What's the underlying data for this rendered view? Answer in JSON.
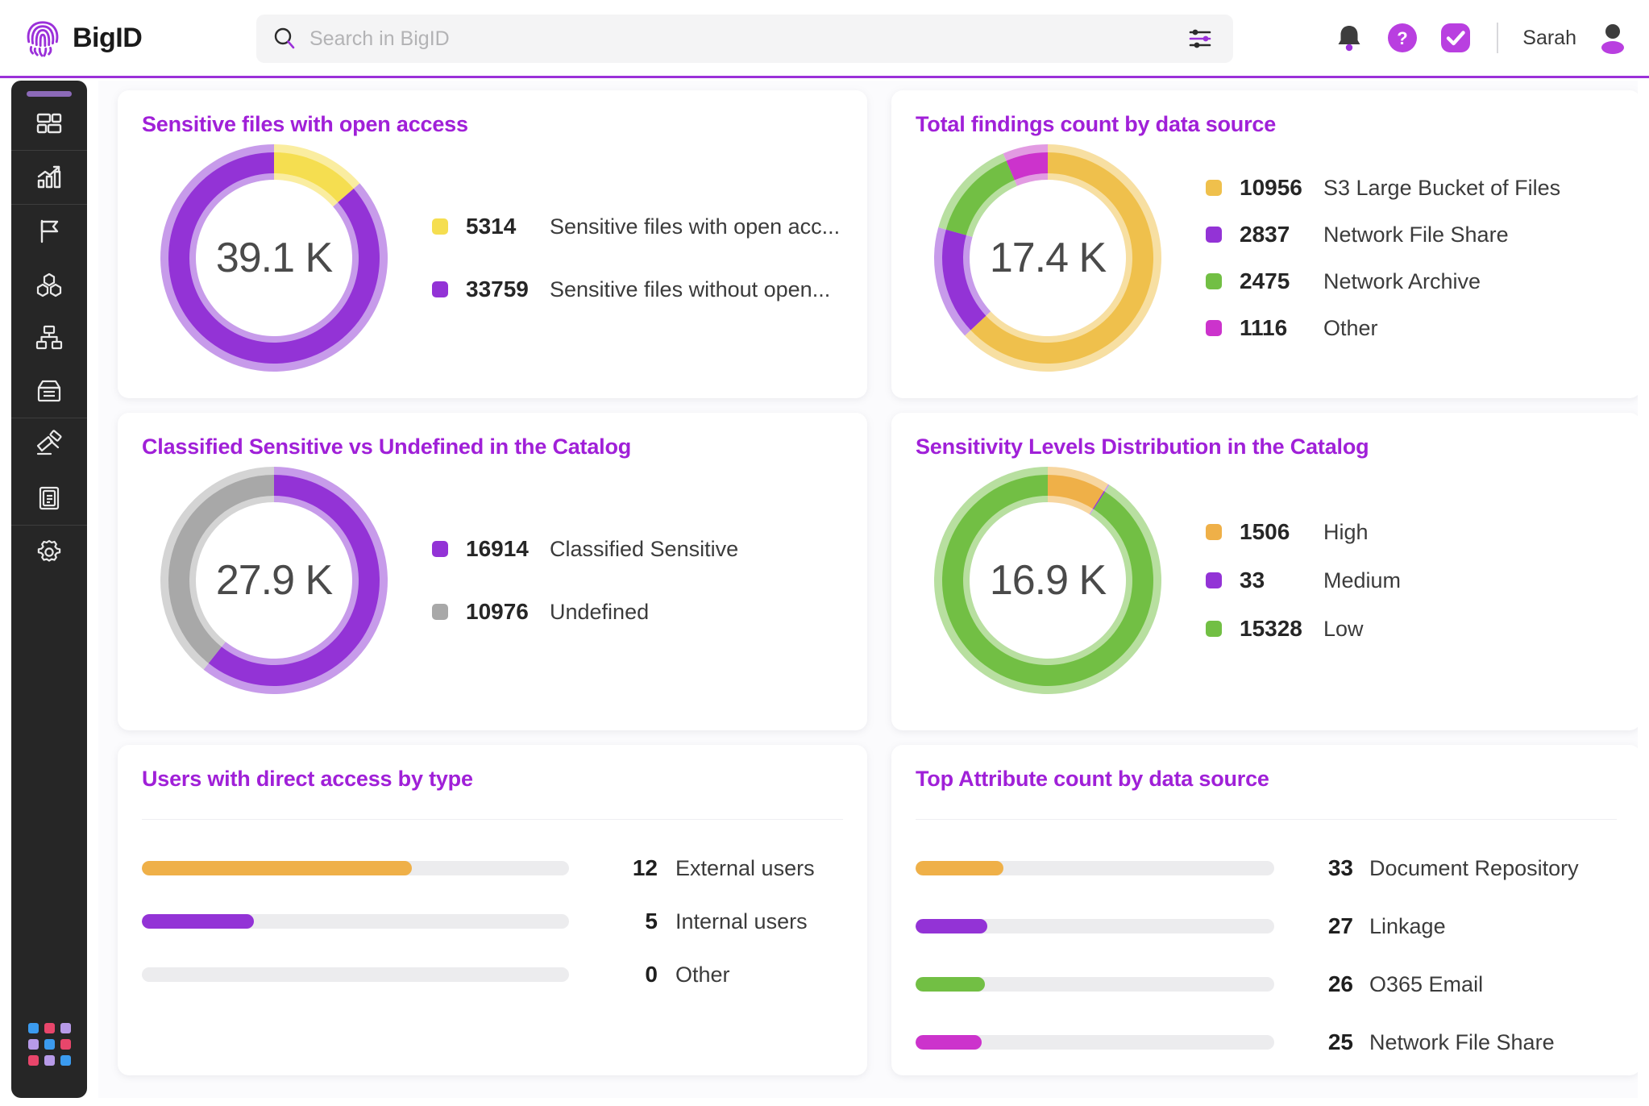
{
  "header": {
    "brand": "BigID",
    "brand_logo_icon": "fingerprint-icon",
    "search_placeholder": "Search in BigID",
    "search_value": "",
    "search_icon": "search-icon",
    "filter_icon": "filter-sliders-icon",
    "notifications_icon": "bell-icon",
    "help_icon": "question-circle-icon",
    "tasks_icon": "check-circle-icon",
    "user_name": "Sarah",
    "avatar_icon": "user-avatar-icon"
  },
  "sidebar": {
    "items": [
      {
        "name": "dashboard",
        "icon": "dashboard-grid-icon"
      },
      {
        "name": "insights",
        "icon": "bar-chart-trend-icon"
      },
      {
        "name": "data-overview",
        "icon": "flag-icon"
      },
      {
        "name": "clusters",
        "icon": "hexagons-icon"
      },
      {
        "name": "data-sources",
        "icon": "sitemap-icon"
      },
      {
        "name": "catalog",
        "icon": "archive-drawer-icon"
      },
      {
        "name": "policies",
        "icon": "gavel-icon"
      },
      {
        "name": "reports",
        "icon": "clipboard-icon"
      },
      {
        "name": "settings",
        "icon": "gear-icon"
      }
    ],
    "app_switcher_icon": "app-grid-dots-icon",
    "dot_colors": [
      "#3b9bef",
      "#e8466b",
      "#b79ae8",
      "#b79ae8",
      "#3b9bef",
      "#e8466b",
      "#e8466b",
      "#b79ae8",
      "#3b9bef"
    ]
  },
  "colors": {
    "brand_purple": "#A020D8",
    "purple": "#9333D6",
    "purple_light": "#C79BEA",
    "yellow": "#F5DE50",
    "yellow_light": "#FAEDA0",
    "amber": "#EFC04C",
    "amber_light": "#F7DFA2",
    "orange": "#EFB048",
    "green": "#72BF44",
    "green_light": "#B8DFA0",
    "magenta": "#CC33CC",
    "magenta_light": "#E29BE2",
    "gray": "#A8A8A8",
    "gray_light": "#D4D4D4",
    "track": "#ECECEE"
  },
  "chart_data": [
    {
      "id": "sensitive-files-open-access",
      "type": "pie",
      "title": "Sensitive files with open access",
      "center_label": "39.1 K",
      "total": 39073,
      "legend_position": "right",
      "slices": [
        {
          "label": "Sensitive files with open acc...",
          "full_label": "Sensitive files with open access",
          "value": 5314,
          "color": "#F5DE50",
          "halo": "#FAEDA0"
        },
        {
          "label": "Sensitive files without open...",
          "full_label": "Sensitive files without open access",
          "value": 33759,
          "color": "#9333D6",
          "halo": "#C79BEA"
        }
      ]
    },
    {
      "id": "total-findings-by-data-source",
      "type": "pie",
      "title": "Total findings count by data source",
      "center_label": "17.4 K",
      "total": 17384,
      "legend_position": "right",
      "slices": [
        {
          "label": "S3 Large Bucket of Files",
          "value": 10956,
          "color": "#EFC04C",
          "halo": "#F7DFA2"
        },
        {
          "label": "Network File Share",
          "value": 2837,
          "color": "#9333D6",
          "halo": "#C79BEA"
        },
        {
          "label": "Network Archive",
          "value": 2475,
          "color": "#72BF44",
          "halo": "#B8DFA0"
        },
        {
          "label": "Other",
          "value": 1116,
          "color": "#CC33CC",
          "halo": "#E29BE2"
        }
      ]
    },
    {
      "id": "classified-sensitive-vs-undefined",
      "type": "pie",
      "title": "Classified Sensitive vs Undefined in the Catalog",
      "center_label": "27.9 K",
      "total": 27890,
      "legend_position": "right",
      "slices": [
        {
          "label": "Classified Sensitive",
          "value": 16914,
          "color": "#9333D6",
          "halo": "#C79BEA"
        },
        {
          "label": "Undefined",
          "value": 10976,
          "color": "#A8A8A8",
          "halo": "#D4D4D4"
        }
      ]
    },
    {
      "id": "sensitivity-levels-distribution",
      "type": "pie",
      "title": "Sensitivity Levels Distribution in the Catalog",
      "center_label": "16.9 K",
      "total": 16867,
      "legend_position": "right",
      "slices": [
        {
          "label": "High",
          "value": 1506,
          "color": "#EFB048",
          "halo": "#F7D6A0"
        },
        {
          "label": "Medium",
          "value": 33,
          "color": "#9333D6",
          "halo": "#C79BEA"
        },
        {
          "label": "Low",
          "value": 15328,
          "color": "#72BF44",
          "halo": "#B8DFA0"
        }
      ]
    },
    {
      "id": "users-direct-access-by-type",
      "type": "bar",
      "orientation": "horizontal",
      "title": "Users with direct access by type",
      "categories": [
        "External users",
        "Internal users",
        "Other"
      ],
      "values": [
        12,
        5,
        0
      ],
      "max": 19,
      "colors": [
        "#EFB048",
        "#9333D6",
        "#ECECEE"
      ],
      "xlabel": "",
      "ylabel": ""
    },
    {
      "id": "top-attribute-count-by-data-source",
      "type": "bar",
      "orientation": "horizontal",
      "title": "Top Attribute count by data source",
      "categories": [
        "Document Repository",
        "Linkage",
        "O365 Email",
        "Network File Share"
      ],
      "values": [
        33,
        27,
        26,
        25
      ],
      "max": 135,
      "colors": [
        "#EFB048",
        "#9333D6",
        "#72BF44",
        "#CC33CC"
      ],
      "xlabel": "",
      "ylabel": ""
    }
  ]
}
